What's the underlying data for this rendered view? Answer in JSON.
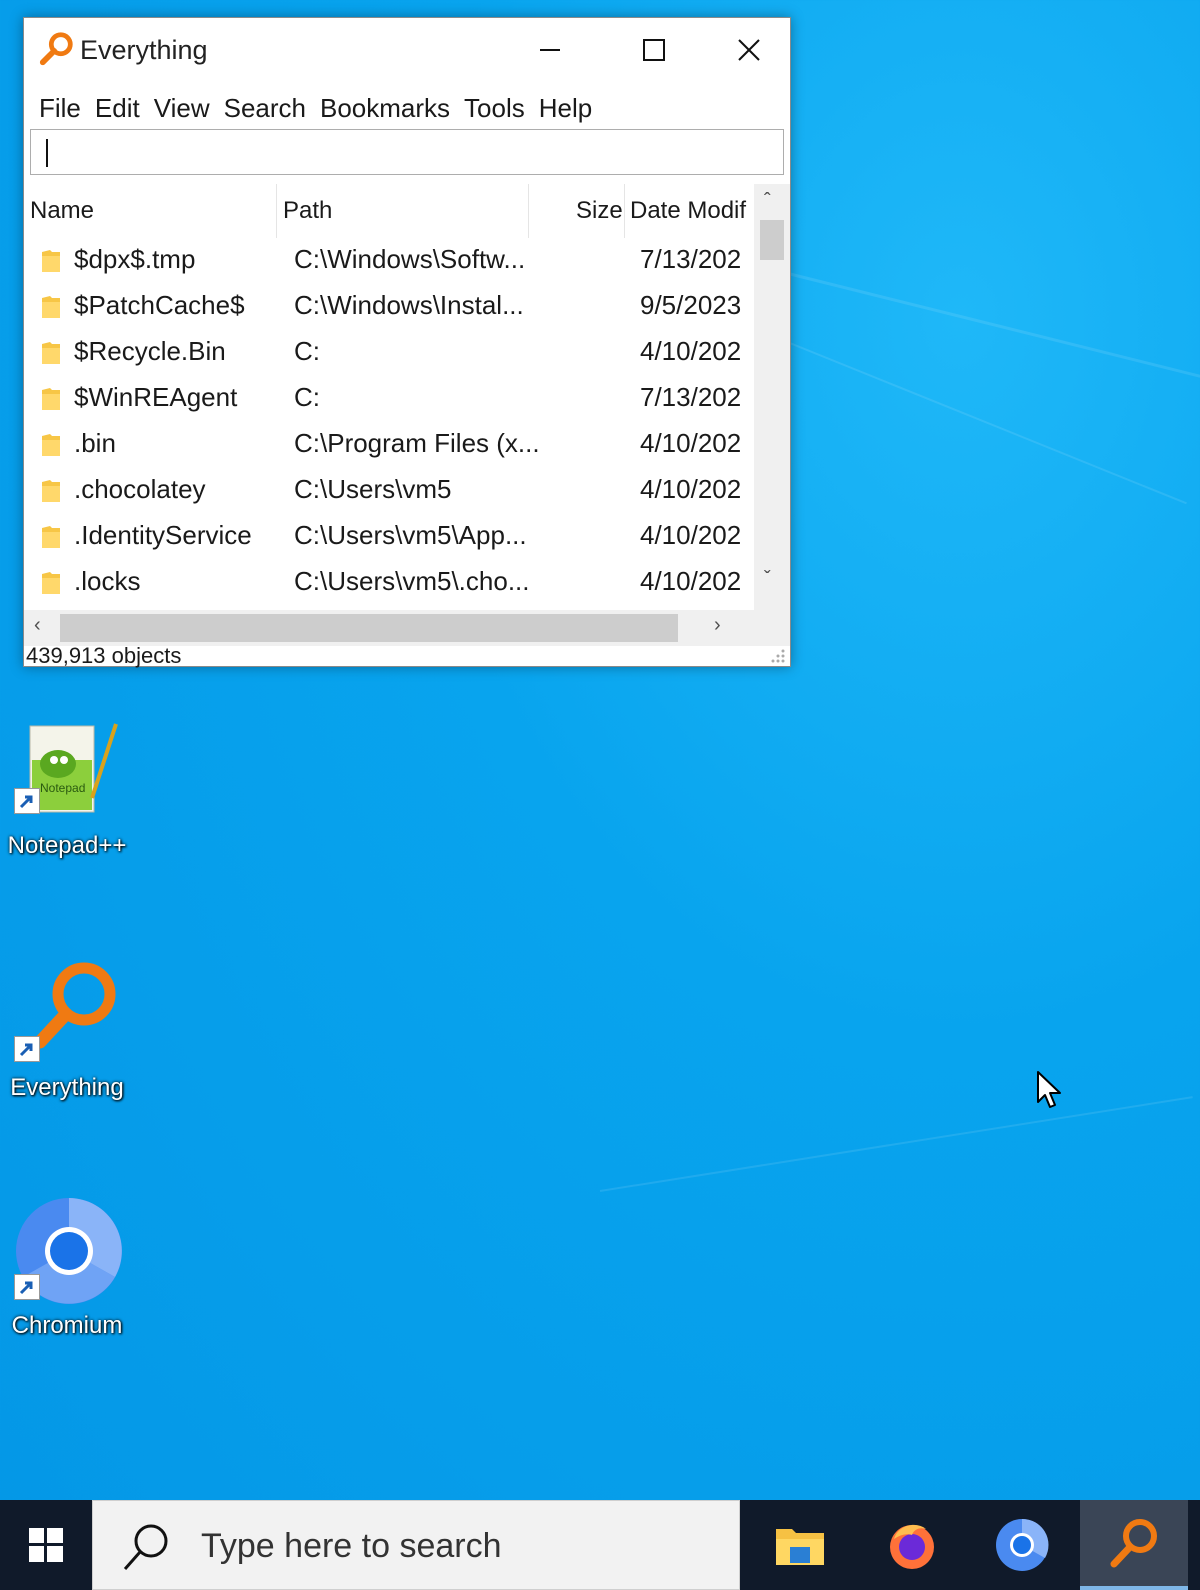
{
  "window": {
    "title": "Everything",
    "menu": [
      "File",
      "Edit",
      "View",
      "Search",
      "Bookmarks",
      "Tools",
      "Help"
    ],
    "search": {
      "value": "",
      "placeholder": ""
    },
    "columns": {
      "name": "Name",
      "path": "Path",
      "size": "Size",
      "date": "Date Modif"
    },
    "rows": [
      {
        "name": "$dpx$.tmp",
        "path": "C:\\Windows\\Softw...",
        "date": "7/13/202"
      },
      {
        "name": "$PatchCache$",
        "path": "C:\\Windows\\Instal...",
        "date": "9/5/2023"
      },
      {
        "name": "$Recycle.Bin",
        "path": "C:",
        "date": "4/10/202"
      },
      {
        "name": "$WinREAgent",
        "path": "C:",
        "date": "7/13/202"
      },
      {
        "name": ".bin",
        "path": "C:\\Program Files (x...",
        "date": "4/10/202"
      },
      {
        "name": ".chocolatey",
        "path": "C:\\Users\\vm5",
        "date": "4/10/202"
      },
      {
        "name": ".IdentityService",
        "path": "C:\\Users\\vm5\\App...",
        "date": "4/10/202"
      },
      {
        "name": ".locks",
        "path": "C:\\Users\\vm5\\.cho...",
        "date": "4/10/202"
      }
    ],
    "status": "439,913 objects"
  },
  "desktop": {
    "icons": [
      {
        "label": "Notepad++"
      },
      {
        "label": "Everything"
      },
      {
        "label": "Chromium"
      }
    ]
  },
  "taskbar": {
    "search_placeholder": "Type here to search",
    "apps": [
      "file-explorer",
      "firefox",
      "chromium",
      "everything"
    ]
  }
}
